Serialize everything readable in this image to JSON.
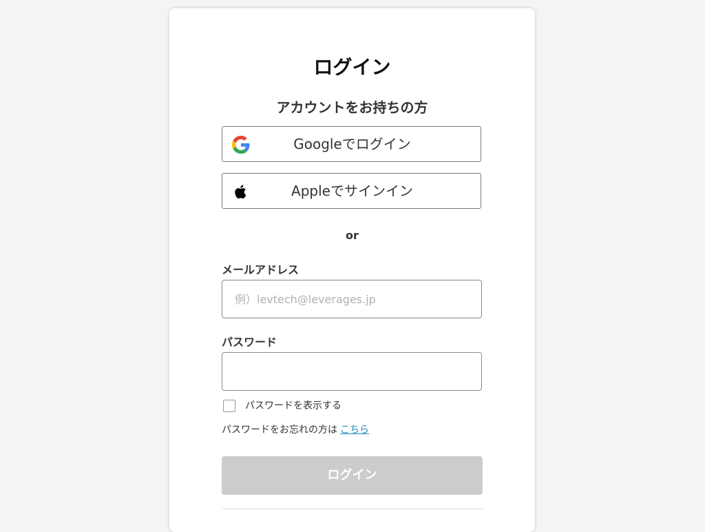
{
  "login": {
    "title": "ログイン",
    "subtitle": "アカウントをお持ちの方",
    "google_button": {
      "label": "Googleでログイン",
      "icon": "google-icon"
    },
    "apple_button": {
      "label": "Appleでサインイン",
      "icon": "apple-icon"
    },
    "or_text": "or",
    "email": {
      "label": "メールアドレス",
      "placeholder": "例）levtech@leverages.jp",
      "value": ""
    },
    "password": {
      "label": "パスワード",
      "value": ""
    },
    "show_password": {
      "label": "パスワードを表示する",
      "checked": false
    },
    "forgot": {
      "text": "パスワードをお忘れの方は",
      "link": "こちら"
    },
    "submit": {
      "label": "ログイン",
      "disabled": true
    }
  },
  "colors": {
    "background": "#f4f4f4",
    "card": "#ffffff",
    "link": "#1a8cb8",
    "submit_disabled": "#cccccc",
    "google_blue": "#4285F4",
    "google_red": "#EA4335",
    "google_yellow": "#FBBC05",
    "google_green": "#34A853"
  }
}
